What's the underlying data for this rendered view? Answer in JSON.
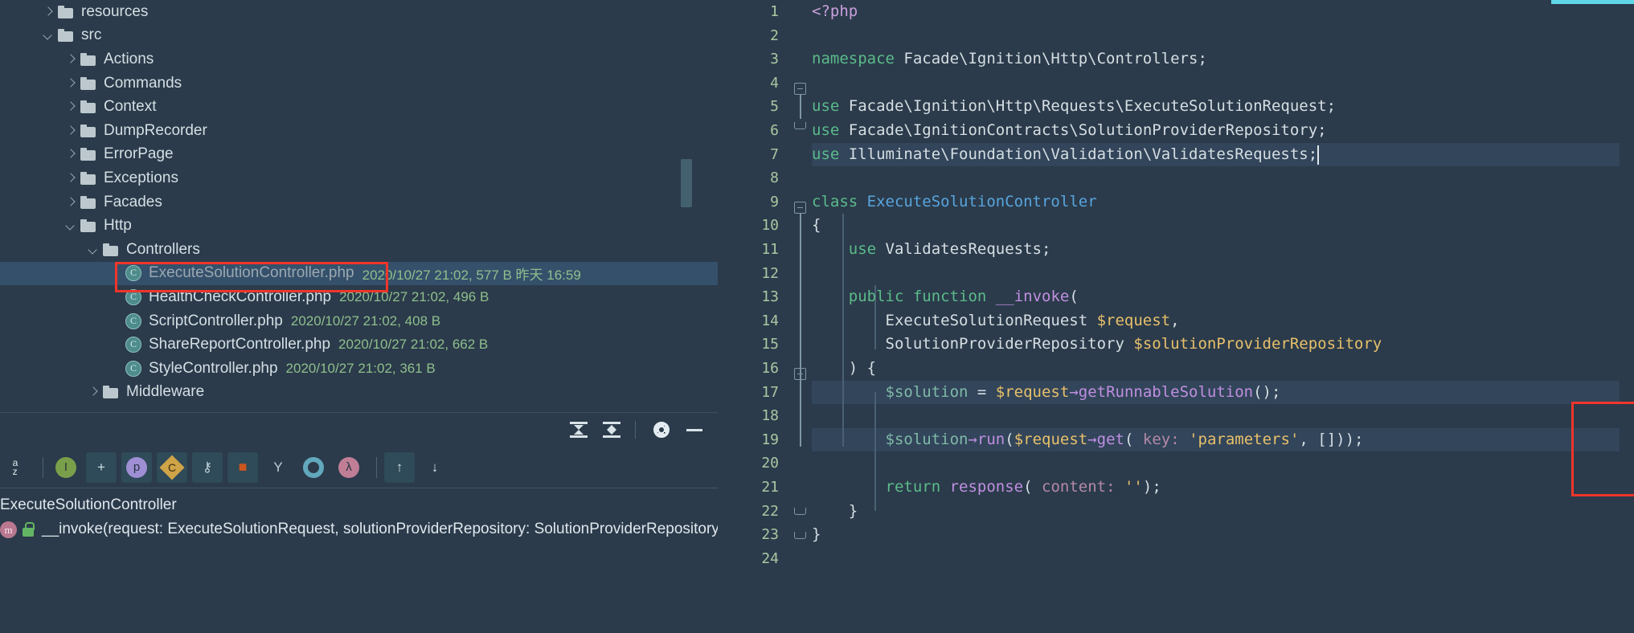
{
  "theme": {
    "bg": "#2b3b4b",
    "selection": "#35506b",
    "annotation_red": "#f0352a",
    "line_number": "#a9c7a2",
    "meta_green": "#8fbf8c",
    "marker_cyan": "#5fd7e8"
  },
  "project_tree": {
    "nodes": [
      {
        "label": "resources",
        "type": "folder",
        "expanded": false,
        "depth": 1,
        "meta": ""
      },
      {
        "label": "src",
        "type": "folder",
        "expanded": true,
        "depth": 1,
        "meta": ""
      },
      {
        "label": "Actions",
        "type": "folder",
        "expanded": false,
        "depth": 2,
        "meta": ""
      },
      {
        "label": "Commands",
        "type": "folder",
        "expanded": false,
        "depth": 2,
        "meta": ""
      },
      {
        "label": "Context",
        "type": "folder",
        "expanded": false,
        "depth": 2,
        "meta": ""
      },
      {
        "label": "DumpRecorder",
        "type": "folder",
        "expanded": false,
        "depth": 2,
        "meta": ""
      },
      {
        "label": "ErrorPage",
        "type": "folder",
        "expanded": false,
        "depth": 2,
        "meta": ""
      },
      {
        "label": "Exceptions",
        "type": "folder",
        "expanded": false,
        "depth": 2,
        "meta": ""
      },
      {
        "label": "Facades",
        "type": "folder",
        "expanded": false,
        "depth": 2,
        "meta": ""
      },
      {
        "label": "Http",
        "type": "folder",
        "expanded": true,
        "depth": 2,
        "meta": ""
      },
      {
        "label": "Controllers",
        "type": "folder",
        "expanded": true,
        "depth": 3,
        "meta": ""
      },
      {
        "label": "ExecuteSolutionController.php",
        "type": "php",
        "expanded": false,
        "depth": 4,
        "meta": "2020/10/27 21:02, 577 B 昨天 16:59",
        "selected": true,
        "dim": true
      },
      {
        "label": "HealthCheckController.php",
        "type": "php",
        "expanded": false,
        "depth": 4,
        "meta": "2020/10/27 21:02, 496 B"
      },
      {
        "label": "ScriptController.php",
        "type": "php",
        "expanded": false,
        "depth": 4,
        "meta": "2020/10/27 21:02, 408 B"
      },
      {
        "label": "ShareReportController.php",
        "type": "php",
        "expanded": false,
        "depth": 4,
        "meta": "2020/10/27 21:02, 662 B"
      },
      {
        "label": "StyleController.php",
        "type": "php",
        "expanded": false,
        "depth": 4,
        "meta": "2020/10/27 21:02, 361 B"
      },
      {
        "label": "Middleware",
        "type": "folder",
        "expanded": false,
        "depth": 3,
        "meta": ""
      }
    ]
  },
  "tool_bar": {
    "buttons": [
      {
        "name": "expand-all-button",
        "icon": "expand-all-icon",
        "tooltip": "Expand All"
      },
      {
        "name": "collapse-all-button",
        "icon": "collapse-all-icon",
        "tooltip": "Collapse All"
      },
      {
        "name": "settings-button",
        "icon": "gear-icon",
        "tooltip": "Settings"
      },
      {
        "name": "hide-button",
        "icon": "minus-icon",
        "tooltip": "Hide"
      }
    ]
  },
  "icon_strip": {
    "items": [
      {
        "name": "sort-alphabetically-icon",
        "glyph": "a\nz",
        "boxed": false,
        "color": "#e2ebef"
      },
      {
        "name": "inheritance-icon",
        "glyph": "I",
        "boxed": false,
        "color": "#7a9f4a"
      },
      {
        "name": "new-file-icon",
        "glyph": "+",
        "boxed": true,
        "color": "#cfe0e6"
      },
      {
        "name": "properties-icon",
        "glyph": "p",
        "boxed": true,
        "color": "#9e8ed4"
      },
      {
        "name": "constants-icon",
        "glyph": "C",
        "boxed": true,
        "color": "#cfa347"
      },
      {
        "name": "key-icon",
        "glyph": "⚷",
        "boxed": true,
        "color": "#bdd0d8"
      },
      {
        "name": "lock-icon",
        "glyph": "■",
        "boxed": true,
        "color": "#c9561f"
      },
      {
        "name": "hierarchy-icon",
        "glyph": "Y",
        "boxed": false,
        "color": "#bdd0d8"
      },
      {
        "name": "interface-icon",
        "glyph": "○",
        "boxed": false,
        "color": "#62a8bd"
      },
      {
        "name": "lambda-icon",
        "glyph": "λ",
        "boxed": false,
        "color": "#c07e96"
      },
      {
        "name": "scroll-from-source-icon",
        "glyph": "↑",
        "boxed": true,
        "color": "#cfe0e6"
      },
      {
        "name": "scroll-to-source-icon",
        "glyph": "↓",
        "boxed": false,
        "color": "#cfe0e6"
      }
    ]
  },
  "structure_view": {
    "class_name": "ExecuteSolutionController",
    "member": "__invoke(request: ExecuteSolutionRequest, solutionProviderRepository: SolutionProviderRepository)"
  },
  "editor": {
    "line_count": 24,
    "first_line": 1,
    "highlighted_lines": [
      7,
      17,
      19
    ],
    "caret_line": 7,
    "lines": [
      {
        "n": 1,
        "tokens": [
          {
            "t": "<?php",
            "c": "t-php"
          }
        ]
      },
      {
        "n": 2,
        "tokens": []
      },
      {
        "n": 3,
        "tokens": [
          {
            "t": "namespace",
            "c": "t-kw"
          },
          {
            "t": " Facade\\Ignition\\Http\\Controllers;",
            "c": "t-plain"
          }
        ]
      },
      {
        "n": 4,
        "tokens": []
      },
      {
        "n": 5,
        "tokens": [
          {
            "t": "use",
            "c": "t-kw"
          },
          {
            "t": " Facade\\Ignition\\Http\\Requests\\ExecuteSolutionRequest;",
            "c": "t-plain"
          }
        ]
      },
      {
        "n": 6,
        "tokens": [
          {
            "t": "use",
            "c": "t-kw"
          },
          {
            "t": " Facade\\IgnitionContracts\\SolutionProviderRepository;",
            "c": "t-plain"
          }
        ]
      },
      {
        "n": 7,
        "tokens": [
          {
            "t": "use",
            "c": "t-kw"
          },
          {
            "t": " Illuminate\\Foundation\\Validation\\ValidatesRequests;",
            "c": "t-plain"
          }
        ]
      },
      {
        "n": 8,
        "tokens": []
      },
      {
        "n": 9,
        "tokens": [
          {
            "t": "class",
            "c": "t-kw"
          },
          {
            "t": " ",
            "c": "t-plain"
          },
          {
            "t": "ExecuteSolutionController",
            "c": "t-cls"
          }
        ]
      },
      {
        "n": 10,
        "tokens": [
          {
            "t": "{",
            "c": "t-punct"
          }
        ]
      },
      {
        "n": 11,
        "tokens": [
          {
            "t": "    ",
            "c": "t-plain"
          },
          {
            "t": "use",
            "c": "t-kw"
          },
          {
            "t": " ValidatesRequests;",
            "c": "t-plain"
          }
        ]
      },
      {
        "n": 12,
        "tokens": []
      },
      {
        "n": 13,
        "tokens": [
          {
            "t": "    ",
            "c": "t-plain"
          },
          {
            "t": "public function",
            "c": "t-kw"
          },
          {
            "t": " ",
            "c": "t-plain"
          },
          {
            "t": "__invoke",
            "c": "t-fn"
          },
          {
            "t": "(",
            "c": "t-punct"
          }
        ]
      },
      {
        "n": 14,
        "tokens": [
          {
            "t": "        ExecuteSolutionRequest ",
            "c": "t-plain"
          },
          {
            "t": "$request",
            "c": "t-var"
          },
          {
            "t": ",",
            "c": "t-punct"
          }
        ]
      },
      {
        "n": 15,
        "tokens": [
          {
            "t": "        SolutionProviderRepository ",
            "c": "t-plain"
          },
          {
            "t": "$solutionProviderRepository",
            "c": "t-var"
          }
        ]
      },
      {
        "n": 16,
        "tokens": [
          {
            "t": "    ) {",
            "c": "t-punct"
          }
        ]
      },
      {
        "n": 17,
        "tokens": [
          {
            "t": "        ",
            "c": "t-plain"
          },
          {
            "t": "$solution",
            "c": "t-dim"
          },
          {
            "t": " = ",
            "c": "t-punct"
          },
          {
            "t": "$request",
            "c": "t-var"
          },
          {
            "t": "→",
            "c": "t-fn"
          },
          {
            "t": "getRunnableSolution",
            "c": "t-fn"
          },
          {
            "t": "();",
            "c": "t-punct"
          }
        ]
      },
      {
        "n": 18,
        "tokens": []
      },
      {
        "n": 19,
        "tokens": [
          {
            "t": "        ",
            "c": "t-plain"
          },
          {
            "t": "$solution",
            "c": "t-dim"
          },
          {
            "t": "→",
            "c": "t-fn"
          },
          {
            "t": "run",
            "c": "t-fn"
          },
          {
            "t": "(",
            "c": "t-punct"
          },
          {
            "t": "$request",
            "c": "t-var"
          },
          {
            "t": "→",
            "c": "t-fn"
          },
          {
            "t": "get",
            "c": "t-fn"
          },
          {
            "t": "( ",
            "c": "t-punct"
          },
          {
            "t": "key:",
            "c": "t-param"
          },
          {
            "t": " ",
            "c": "t-plain"
          },
          {
            "t": "'parameters'",
            "c": "t-str"
          },
          {
            "t": ", []));",
            "c": "t-punct"
          }
        ]
      },
      {
        "n": 20,
        "tokens": []
      },
      {
        "n": 21,
        "tokens": [
          {
            "t": "        ",
            "c": "t-plain"
          },
          {
            "t": "return",
            "c": "t-kw"
          },
          {
            "t": " ",
            "c": "t-plain"
          },
          {
            "t": "response",
            "c": "t-fn"
          },
          {
            "t": "( ",
            "c": "t-punct"
          },
          {
            "t": "content:",
            "c": "t-param"
          },
          {
            "t": " ",
            "c": "t-plain"
          },
          {
            "t": "''",
            "c": "t-str"
          },
          {
            "t": ");",
            "c": "t-punct"
          }
        ]
      },
      {
        "n": 22,
        "tokens": [
          {
            "t": "    }",
            "c": "t-punct"
          }
        ]
      },
      {
        "n": 23,
        "tokens": [
          {
            "t": "}",
            "c": "t-punct"
          }
        ]
      },
      {
        "n": 24,
        "tokens": []
      }
    ]
  },
  "annotations": {
    "file_box_label": "ExecuteSolutionController.php highlighted in project tree",
    "code_box_label": "solution execution block highlighted in editor"
  }
}
